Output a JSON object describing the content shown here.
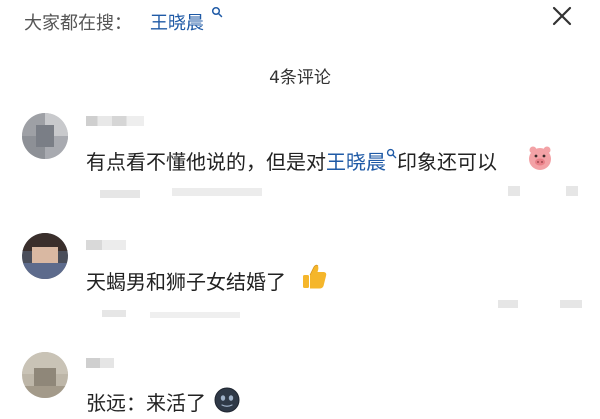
{
  "search_bar": {
    "label": "大家都在搜：",
    "term": "王晓晨"
  },
  "comments_header": {
    "count_label": "4条评论"
  },
  "comments": [
    {
      "text_before": "有点看不懂他说的，但是对",
      "mention": "王晓晨",
      "text_after": "印象还可以",
      "emoji": "pig-face"
    },
    {
      "text": "天蝎男和狮子女结婚了",
      "emoji": "thumbs-up"
    },
    {
      "text": "张远：来活了",
      "emoji": "dark-face"
    }
  ],
  "colors": {
    "link": "#1f5aa6",
    "emoji_thumb": "#f5b62b",
    "emoji_pig": "#f3a2a6",
    "emoji_dark": "#2f3947"
  }
}
